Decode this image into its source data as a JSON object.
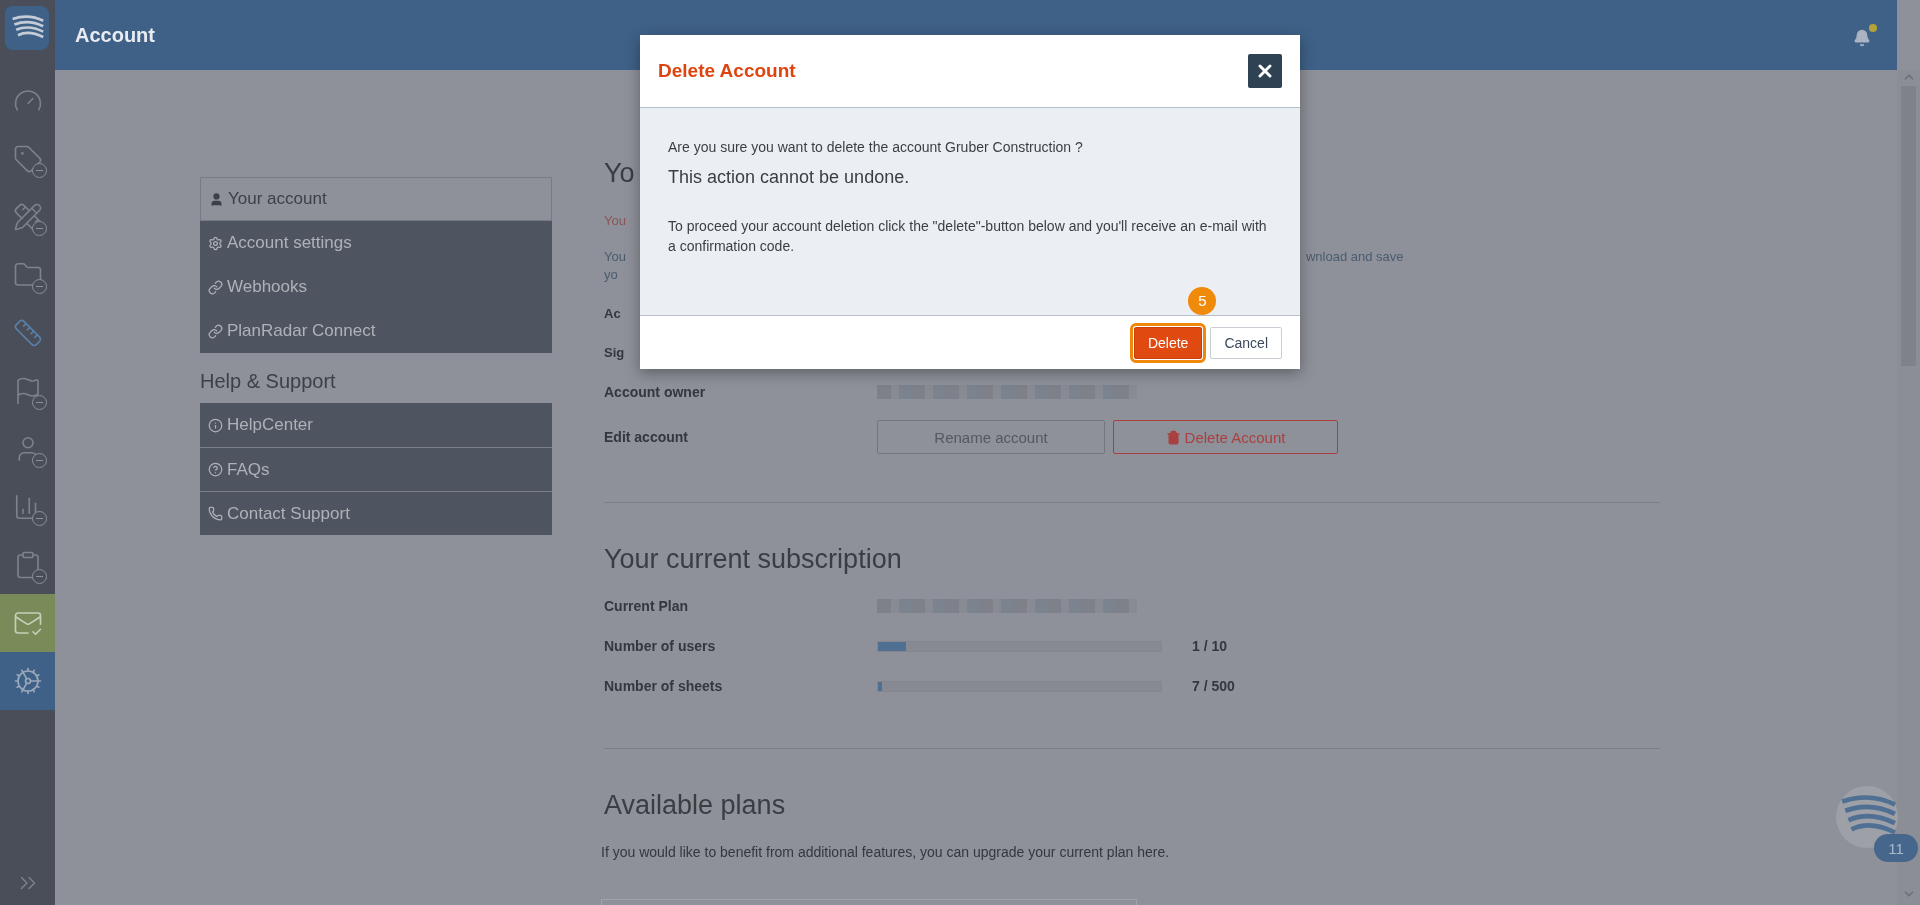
{
  "sidebar": {
    "items": [
      {
        "kind": "gauge",
        "locked": false,
        "selected": false,
        "highlighted": false
      },
      {
        "kind": "tag",
        "locked": true,
        "selected": false,
        "highlighted": false
      },
      {
        "kind": "tools",
        "locked": true,
        "selected": false,
        "highlighted": false
      },
      {
        "kind": "folder",
        "locked": true,
        "selected": false,
        "highlighted": false
      },
      {
        "kind": "ruler",
        "locked": false,
        "selected": false,
        "highlighted": false
      },
      {
        "kind": "flag",
        "locked": true,
        "selected": false,
        "highlighted": false
      },
      {
        "kind": "person",
        "locked": true,
        "selected": false,
        "highlighted": false
      },
      {
        "kind": "chart",
        "locked": true,
        "selected": false,
        "highlighted": false
      },
      {
        "kind": "clipboard",
        "locked": true,
        "selected": false,
        "highlighted": false
      },
      {
        "kind": "mail",
        "locked": false,
        "selected": false,
        "highlighted": true
      },
      {
        "kind": "gears",
        "locked": false,
        "selected": true,
        "highlighted": false
      }
    ]
  },
  "header": {
    "title": "Account",
    "notification_dot": true
  },
  "menu": {
    "groups": [
      {
        "divided": false,
        "items": [
          {
            "label": "Your account",
            "selected": true
          },
          {
            "label": "Account settings",
            "selected": false
          },
          {
            "label": "Webhooks",
            "selected": false
          },
          {
            "label": "PlanRadar Connect",
            "selected": false
          }
        ]
      },
      {
        "heading": "Help & Support",
        "divided": true,
        "items": [
          {
            "label": "HelpCenter",
            "selected": false
          },
          {
            "label": "FAQs",
            "selected": false
          },
          {
            "label": "Contact Support",
            "selected": false
          }
        ]
      }
    ]
  },
  "account_section": {
    "heading_fragment": "Yo",
    "fragments": [
      {
        "kind": "notice",
        "text": "You"
      },
      {
        "kind": "split",
        "left": "You",
        "right": "wnload and save"
      },
      {
        "kind": "plain",
        "text": "yo"
      },
      {
        "kind": "label",
        "text": "Ac"
      },
      {
        "kind": "label",
        "text": "Sig"
      }
    ],
    "rows": [
      {
        "label": "Account owner",
        "redacted": true
      },
      {
        "label": "Edit account",
        "buttons": [
          {
            "label": "Rename account",
            "kind": "secondary"
          },
          {
            "label": "Delete Account",
            "kind": "danger"
          }
        ]
      }
    ]
  },
  "subscription": {
    "heading": "Your current subscription",
    "rows": [
      {
        "label": "Current Plan",
        "redacted": true
      },
      {
        "label": "Number of users",
        "level": 0.1,
        "reading": "1 / 10"
      },
      {
        "label": "Number of sheets",
        "level": 0.014,
        "reading": "7 / 500"
      }
    ]
  },
  "plans": {
    "heading": "Available plans",
    "text": "If you would like to benefit from additional features, you can upgrade your current plan here."
  },
  "chat_widget": {
    "badge": "11"
  },
  "dialog": {
    "title": "Delete Account",
    "question": "Are you sure you want to delete the account Gruber Construction ?",
    "warning": "This action cannot be undone.",
    "instructions": "To proceed your account deletion click the \"delete\"-button below and you'll receive an e-mail with a confirmation code.",
    "step_badge": "5",
    "buttons": [
      {
        "label": "Delete",
        "kind": "primary",
        "highlighted": true
      },
      {
        "label": "Cancel",
        "kind": "secondary",
        "highlighted": false
      }
    ]
  }
}
